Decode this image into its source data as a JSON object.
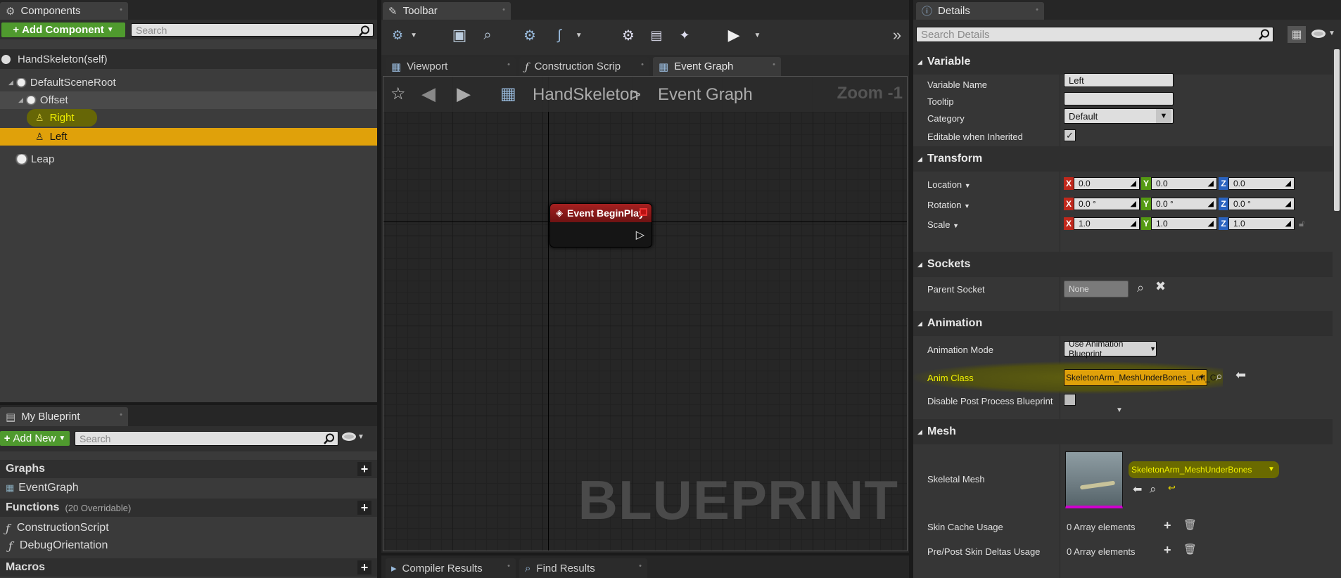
{
  "components": {
    "tab_label": "Components",
    "add_button": "Add Component",
    "search_placeholder": "Search",
    "self_item": "HandSkeleton(self)",
    "tree": [
      {
        "label": "DefaultSceneRoot"
      },
      {
        "label": "Offset"
      },
      {
        "label": "Right"
      },
      {
        "label": "Left"
      },
      {
        "label": "Leap"
      }
    ]
  },
  "my_blueprint": {
    "tab_label": "My Blueprint",
    "add_new": "Add New",
    "search_placeholder": "Search",
    "graphs_label": "Graphs",
    "event_graph": "EventGraph",
    "functions_label": "Functions",
    "functions_note": "(20 Overridable)",
    "functions": [
      "ConstructionScript",
      "DebugOrientation"
    ],
    "macros_label": "Macros"
  },
  "toolbar": {
    "tab_label": "Toolbar"
  },
  "graph": {
    "tabs": [
      "Viewport",
      "Construction Scrip",
      "Event Graph"
    ],
    "breadcrumb_root": "HandSkeleton",
    "breadcrumb_sep": ">",
    "breadcrumb_leaf": "Event Graph",
    "zoom": "Zoom -1",
    "node_title": "Event BeginPlay",
    "watermark": "BLUEPRINT"
  },
  "bottom_tabs": [
    "Compiler Results",
    "Find Results"
  ],
  "details": {
    "tab_label": "Details",
    "search_placeholder": "Search Details",
    "sections": {
      "variable": "Variable",
      "transform": "Transform",
      "sockets": "Sockets",
      "animation": "Animation",
      "mesh": "Mesh"
    },
    "variable_name_label": "Variable Name",
    "variable_name_value": "Left",
    "tooltip_label": "Tooltip",
    "category_label": "Category",
    "category_value": "Default",
    "editable_label": "Editable when Inherited",
    "location_label": "Location",
    "rotation_label": "Rotation",
    "scale_label": "Scale",
    "location": [
      "0.0",
      "0.0",
      "0.0"
    ],
    "rotation": [
      "0.0 °",
      "0.0 °",
      "0.0 °"
    ],
    "scale": [
      "1.0",
      "1.0",
      "1.0"
    ],
    "axis_labels": [
      "X",
      "Y",
      "Z"
    ],
    "parent_socket_label": "Parent Socket",
    "parent_socket_value": "None",
    "anim_mode_label": "Animation Mode",
    "anim_mode_value": "Use Animation Blueprint",
    "anim_class_label": "Anim Class",
    "anim_class_value": "SkeletonArm_MeshUnderBones_Left_C",
    "disable_pp_label": "Disable Post Process Blueprint",
    "skeletal_mesh_label": "Skeletal Mesh",
    "skeletal_mesh_value": "SkeletonArm_MeshUnderBones",
    "skin_cache_label": "Skin Cache Usage",
    "skin_cache_value": "0 Array elements",
    "skin_deltas_label": "Pre/Post Skin Deltas Usage",
    "skin_deltas_value": "0 Array elements"
  },
  "colors": {
    "accent": "#e0a10a",
    "highlight": "#f0f000",
    "green": "#4f9a2e",
    "node_red": "#9b1c1c"
  }
}
